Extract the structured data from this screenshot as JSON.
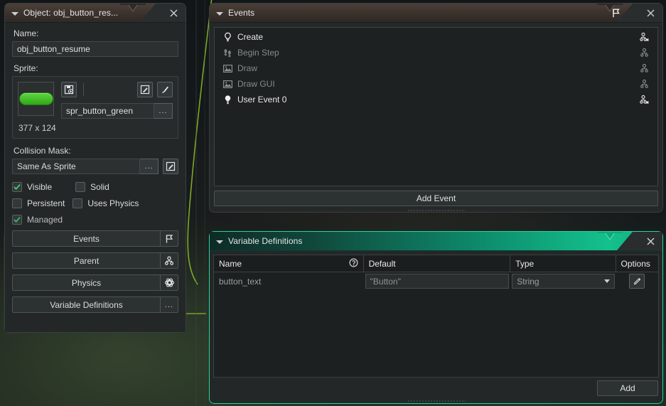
{
  "object_panel": {
    "title": "Object: obj_button_res...",
    "close_icon": "close-icon",
    "collapse_icon": "collapse-triangle-icon",
    "name_label": "Name:",
    "name_value": "obj_button_resume",
    "sprite_label": "Sprite:",
    "sprite_name": "spr_button_green",
    "sprite_dimensions": "377 x 124",
    "sprite_new_icon": "new-sprite-icon",
    "sprite_edit_icon": "edit-sprite-icon",
    "sprite_paint_icon": "paint-brush-icon",
    "sprite_menu_label": "...",
    "collision_label": "Collision Mask:",
    "collision_value": "Same As Sprite",
    "collision_menu_label": "...",
    "collision_edit_icon": "edit-mask-icon",
    "checkboxes": [
      {
        "label": "Visible",
        "checked": true,
        "dim": false
      },
      {
        "label": "Solid",
        "checked": false,
        "dim": false
      },
      {
        "label": "Persistent",
        "checked": false,
        "dim": false
      },
      {
        "label": "Uses Physics",
        "checked": false,
        "dim": false
      },
      {
        "label": "Managed",
        "checked": true,
        "dim": true
      }
    ],
    "buttons": [
      {
        "label": "Events",
        "icon": "flag-icon",
        "cap_text": ""
      },
      {
        "label": "Parent",
        "icon": "parent-tree-icon",
        "cap_text": ""
      },
      {
        "label": "Physics",
        "icon": "physics-atom-icon",
        "cap_text": ""
      },
      {
        "label": "Variable Definitions",
        "icon": "ellipsis-icon",
        "cap_text": "..."
      }
    ]
  },
  "events_panel": {
    "title": "Events",
    "header_icon": "flag-icon",
    "close_icon": "close-icon",
    "collapse_icon": "collapse-triangle-icon",
    "events": [
      {
        "label": "Create",
        "icon": "lightbulb-outline-icon",
        "inherited": false,
        "right_icon": "override-icon"
      },
      {
        "label": "Begin Step",
        "icon": "footsteps-icon",
        "inherited": true,
        "right_icon": "inherit-icon"
      },
      {
        "label": "Draw",
        "icon": "picture-icon",
        "inherited": true,
        "right_icon": "inherit-icon"
      },
      {
        "label": "Draw GUI",
        "icon": "picture-icon",
        "inherited": true,
        "right_icon": "inherit-icon"
      },
      {
        "label": "User Event 0",
        "icon": "lightbulb-filled-icon",
        "inherited": false,
        "right_icon": "override-icon"
      }
    ],
    "add_event_label": "Add Event"
  },
  "variables_panel": {
    "title": "Variable Definitions",
    "close_icon": "close-icon",
    "collapse_icon": "collapse-triangle-icon",
    "columns": [
      "Name",
      "Default",
      "Type",
      "Options"
    ],
    "name_help_icon": "help-circle-icon",
    "rows": [
      {
        "name": "button_text",
        "default": "\"Button\"",
        "type": "String",
        "options_icon": "pencil-edit-icon"
      }
    ],
    "add_label": "Add"
  },
  "colors": {
    "accent_teal": "#14c18d",
    "panel_bg": "#232727",
    "title_brown": "#3b322d",
    "check_green": "#3ecf6e",
    "sprite_green": "#2faa18",
    "background_curve": "#8fc229"
  }
}
